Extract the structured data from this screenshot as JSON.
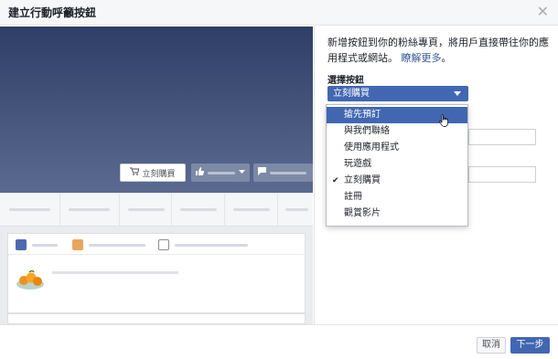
{
  "dialog": {
    "title": "建立行動呼籲按鈕",
    "close_icon": "close-icon"
  },
  "preview": {
    "cta_label": "立刻購買",
    "cta_icon": "cart-icon",
    "like_icon": "thumbs-up-icon",
    "message_icon": "message-icon"
  },
  "panel": {
    "description": "新增按鈕到你的粉絲專頁，將用戶直接帶往你的應用程式或網站。",
    "learn_more": "瞭解更多",
    "learn_more_suffix": "。",
    "section_label": "選擇按鈕",
    "selected_value": "立刻購買"
  },
  "dropdown": {
    "options": [
      {
        "label": "搶先預訂",
        "highlighted": true,
        "checked": false
      },
      {
        "label": "與我們聯絡",
        "highlighted": false,
        "checked": false
      },
      {
        "label": "使用應用程式",
        "highlighted": false,
        "checked": false
      },
      {
        "label": "玩遊戲",
        "highlighted": false,
        "checked": false
      },
      {
        "label": "立刻購買",
        "highlighted": false,
        "checked": true
      },
      {
        "label": "註冊",
        "highlighted": false,
        "checked": false
      },
      {
        "label": "觀賞影片",
        "highlighted": false,
        "checked": false
      }
    ],
    "check_glyph": "✔"
  },
  "footer": {
    "cancel_label": "取消",
    "next_label": "下一步"
  },
  "colors": {
    "brand": "#4267b2",
    "link": "#365899",
    "cover": "#3b4a70"
  }
}
